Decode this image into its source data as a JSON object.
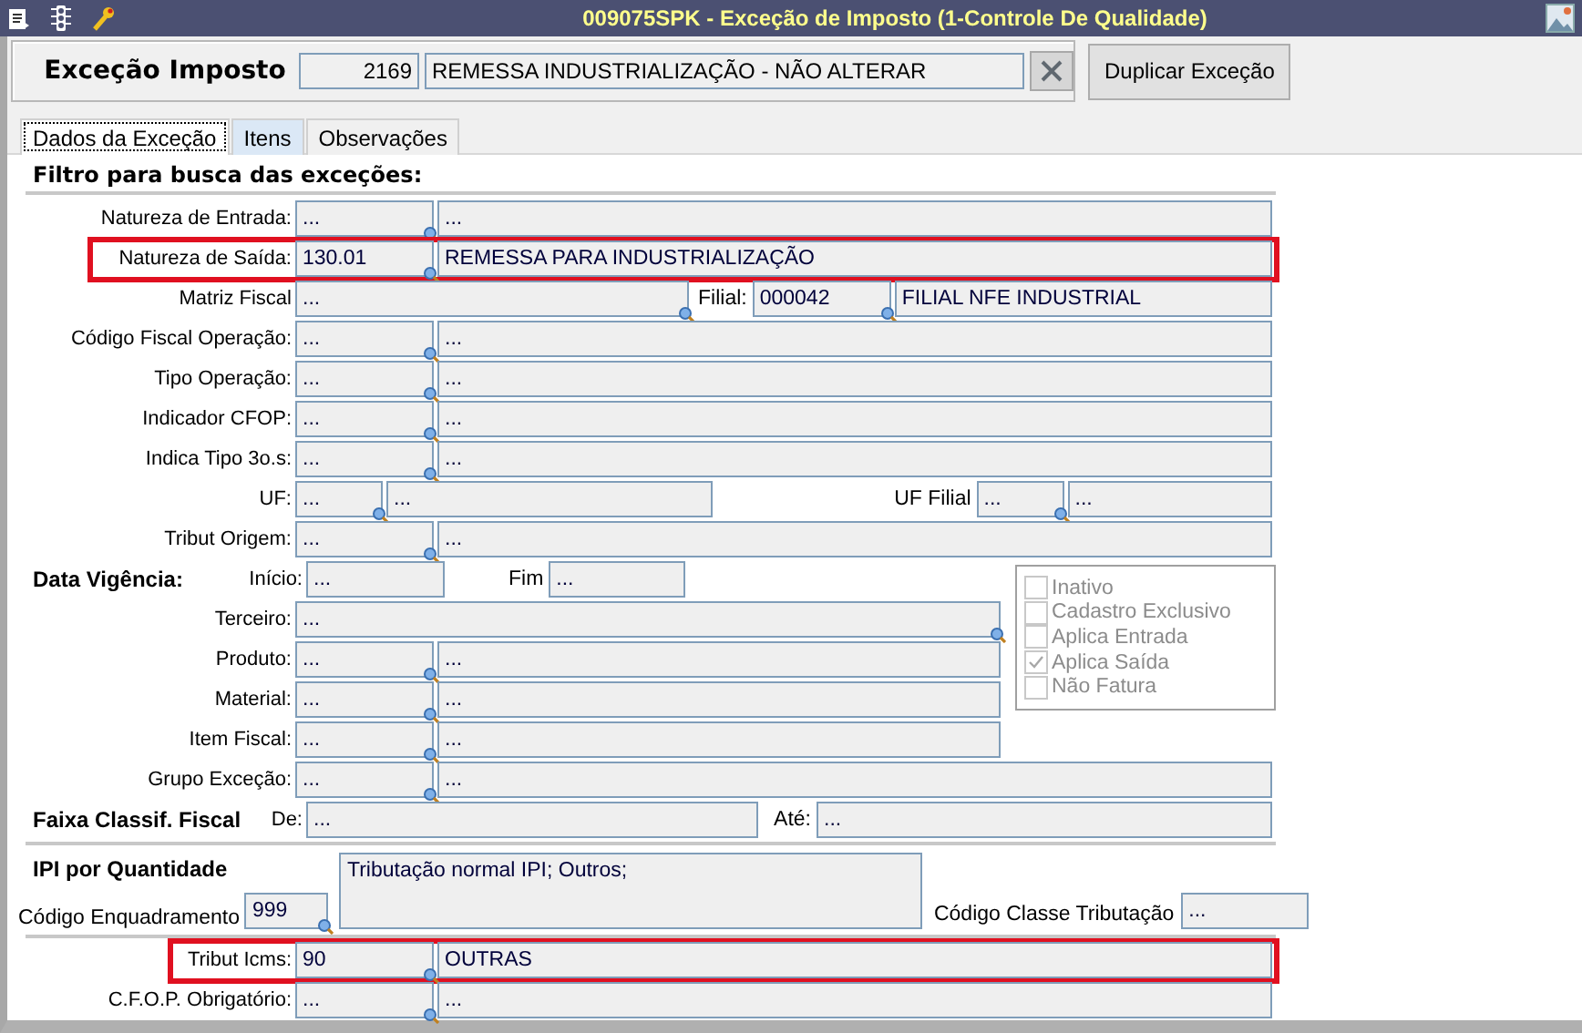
{
  "window": {
    "title": "009075SPK - Exceção de Imposto (1-Controle De Qualidade)"
  },
  "header": {
    "label": "Exceção Imposto",
    "code": "2169",
    "description": "REMESSA INDUSTRIALIZAÇÃO - NÃO ALTERAR",
    "duplicate_button": "Duplicar Exceção"
  },
  "tabs": [
    {
      "label": "Dados da Exceção",
      "selected": true
    },
    {
      "label": "Itens",
      "selected": false
    },
    {
      "label": "Observações",
      "selected": false
    }
  ],
  "filter_title": "Filtro para busca das exceções:",
  "rows": [
    {
      "kind": "pair",
      "label": "Natureza de Entrada:",
      "code": "...",
      "description": "...",
      "highlighted": false
    },
    {
      "kind": "pair",
      "label": "Natureza de Saída:",
      "code": "130.01",
      "description": "REMESSA PARA INDUSTRIALIZAÇÃO",
      "highlighted": true
    },
    {
      "kind": "matriz",
      "label": "Matriz Fiscal",
      "value": "...",
      "second_label": "Filial:",
      "code": "000042",
      "description": "FILIAL NFE INDUSTRIAL",
      "highlighted": false
    },
    {
      "kind": "pair",
      "label": "Código Fiscal Operação:",
      "code": "...",
      "description": "...",
      "highlighted": false
    },
    {
      "kind": "pair",
      "label": "Tipo Operação:",
      "code": "...",
      "description": "...",
      "highlighted": false
    },
    {
      "kind": "pair",
      "label": "Indicador CFOP:",
      "code": "...",
      "description": "...",
      "highlighted": false
    },
    {
      "kind": "pair",
      "label": "Indica Tipo 3o.s:",
      "code": "...",
      "description": "...",
      "highlighted": false
    },
    {
      "kind": "uf",
      "label": "UF:",
      "code": "...",
      "description": "...",
      "second_label": "UF Filial",
      "second_code": "...",
      "second_description": "...",
      "highlighted": false
    },
    {
      "kind": "pair",
      "label": "Tribut Origem:",
      "code": "...",
      "description": "...",
      "highlighted": false
    }
  ],
  "validity": {
    "section": "Data Vigência:",
    "start_label": "Início:",
    "start": "...",
    "end_label": "Fim",
    "end": "..."
  },
  "short_rows": [
    {
      "kind": "single",
      "label": "Terceiro:",
      "value": "..."
    },
    {
      "kind": "pair",
      "label": "Produto:",
      "code": "...",
      "description": "..."
    },
    {
      "kind": "pair",
      "label": "Material:",
      "code": "...",
      "description": "..."
    },
    {
      "kind": "pair",
      "label": "Item Fiscal:",
      "code": "...",
      "description": "..."
    }
  ],
  "checks": [
    {
      "label": "Inativo",
      "checked": false,
      "disabled": true
    },
    {
      "label": "Cadastro Exclusivo",
      "checked": false,
      "disabled": true
    },
    {
      "label": "Aplica Entrada",
      "checked": false,
      "disabled": true
    },
    {
      "label": "Aplica Saída",
      "checked": true,
      "disabled": true
    },
    {
      "label": "Não Fatura",
      "checked": false,
      "disabled": true
    }
  ],
  "group_row": {
    "label": "Grupo Exceção:",
    "code": "...",
    "description": "..."
  },
  "range": {
    "section": "Faixa Classif. Fiscal",
    "from_label": "De:",
    "from": "...",
    "to_label": "Até:",
    "to": "..."
  },
  "ipi": {
    "title": "IPI por Quantidade",
    "code_label": "Código Enquadramento",
    "code": "999",
    "description": "Tributação normal IPI; Outros;",
    "class_label": "Código Classe Tributação",
    "class_value": "..."
  },
  "icms_rows": [
    {
      "kind": "pair",
      "label": "Tribut Icms:",
      "code": "90",
      "description": "OUTRAS",
      "highlighted": true
    },
    {
      "kind": "pair",
      "label": "C.F.O.P. Obrigatório:",
      "code": "...",
      "description": "...",
      "highlighted": false
    }
  ]
}
